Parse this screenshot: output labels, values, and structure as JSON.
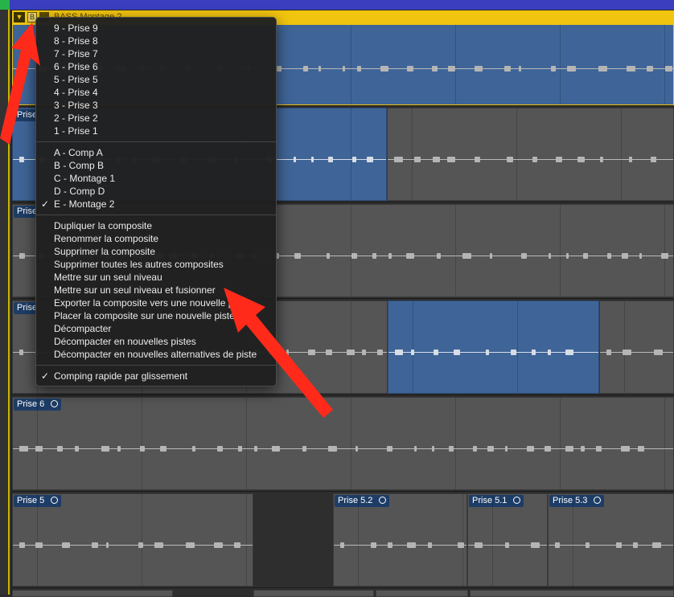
{
  "colors": {
    "comp_header": "#f1c40f",
    "region_selected": "#3f6598",
    "region": "#555555",
    "arrow": "#ff2a1a",
    "menu_bg": "#202020"
  },
  "comp_track": {
    "name": "BASS Montage 2",
    "collapse_icon": "triangle-down-icon",
    "buttons": [
      "B"
    ]
  },
  "lanes": [
    {
      "regions": [
        {
          "label": "Prise"
        }
      ]
    },
    {
      "regions": [
        {
          "label": "Prise"
        }
      ]
    },
    {
      "regions": [
        {
          "label": "Prise"
        }
      ]
    },
    {
      "regions": [
        {
          "label": "Prise 6"
        }
      ]
    },
    {
      "regions": [
        {
          "label": "Prise 5"
        },
        {
          "label": "Prise 5.2"
        },
        {
          "label": "Prise 5.1"
        },
        {
          "label": "Prise 5.3"
        }
      ]
    }
  ],
  "menu": {
    "takes": [
      "9 - Prise 9",
      "8 - Prise 8",
      "7 - Prise 7",
      "6 - Prise 6",
      "5 - Prise 5",
      "4 - Prise 4",
      "3 - Prise 3",
      "2 - Prise 2",
      "1 - Prise 1"
    ],
    "comps": [
      {
        "label": "A - Comp A",
        "checked": false
      },
      {
        "label": "B - Comp B",
        "checked": false
      },
      {
        "label": "C - Montage 1",
        "checked": false
      },
      {
        "label": "D - Comp D",
        "checked": false
      },
      {
        "label": "E - Montage 2",
        "checked": true
      }
    ],
    "actions": [
      "Dupliquer la composite",
      "Renommer la composite",
      "Supprimer la composite",
      "Supprimer toutes les autres composites",
      "Mettre sur un seul niveau",
      "Mettre sur un seul niveau et fusionner",
      "Exporter la composite vers une nouvelle piste",
      "Placer la composite sur une nouvelle piste",
      "Décompacter",
      "Décompacter en nouvelles pistes",
      "Décompacter en nouvelles alternatives de piste"
    ],
    "quick_swipe": {
      "label": "Comping rapide par glissement",
      "checked": true
    }
  }
}
